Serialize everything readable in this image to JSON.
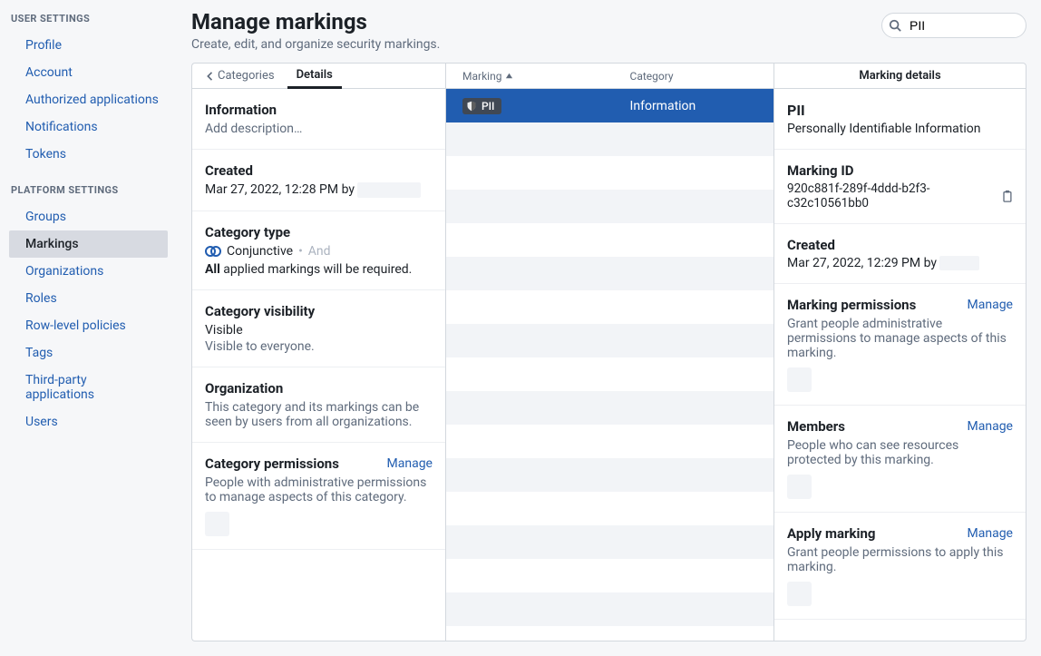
{
  "sidebar": {
    "user_title": "USER SETTINGS",
    "platform_title": "PLATFORM SETTINGS",
    "user_items": [
      "Profile",
      "Account",
      "Authorized applications",
      "Notifications",
      "Tokens"
    ],
    "platform_items": [
      "Groups",
      "Markings",
      "Organizations",
      "Roles",
      "Row-level policies",
      "Tags",
      "Third-party applications",
      "Users"
    ],
    "selected": "Markings"
  },
  "header": {
    "title": "Manage markings",
    "subtitle": "Create, edit, and organize security markings.",
    "search_value": "PII"
  },
  "left": {
    "back_label": "Categories",
    "tab_label": "Details",
    "info_title": "Information",
    "info_sub": "Add description…",
    "created_title": "Created",
    "created_value": "Mar 27, 2022, 12:28 PM by ",
    "cattype_title": "Category type",
    "cattype_value": "Conjunctive",
    "cattype_sep": " • ",
    "cattype_and": "And",
    "cattype_note_strong": "All",
    "cattype_note_rest": " applied markings will be required.",
    "vis_title": "Category visibility",
    "vis_value": "Visible",
    "vis_note": "Visible to everyone.",
    "org_title": "Organization",
    "org_note": "This category and its markings can be seen by users from all organizations.",
    "catperm_title": "Category permissions",
    "catperm_note": "People with administrative permissions to manage aspects of this category.",
    "manage": "Manage"
  },
  "mid": {
    "col_mark": "Marking",
    "col_cat": "Category",
    "row_pill": "PII",
    "row_cat": "Information"
  },
  "right": {
    "header": "Marking details",
    "name": "PII",
    "desc": "Personally Identifiable Information",
    "markid_label": "Marking ID",
    "markid_value": "920c881f-289f-4ddd-b2f3-c32c10561bb0",
    "created_label": "Created",
    "created_value": "Mar 27, 2022, 12:29 PM by ",
    "mp_label": "Marking permissions",
    "mp_note": "Grant people administrative permissions to manage aspects of this marking.",
    "mem_label": "Members",
    "mem_note": "People who can see resources protected by this marking.",
    "apply_label": "Apply marking",
    "apply_note": "Grant people permissions to apply this marking.",
    "manage": "Manage"
  }
}
